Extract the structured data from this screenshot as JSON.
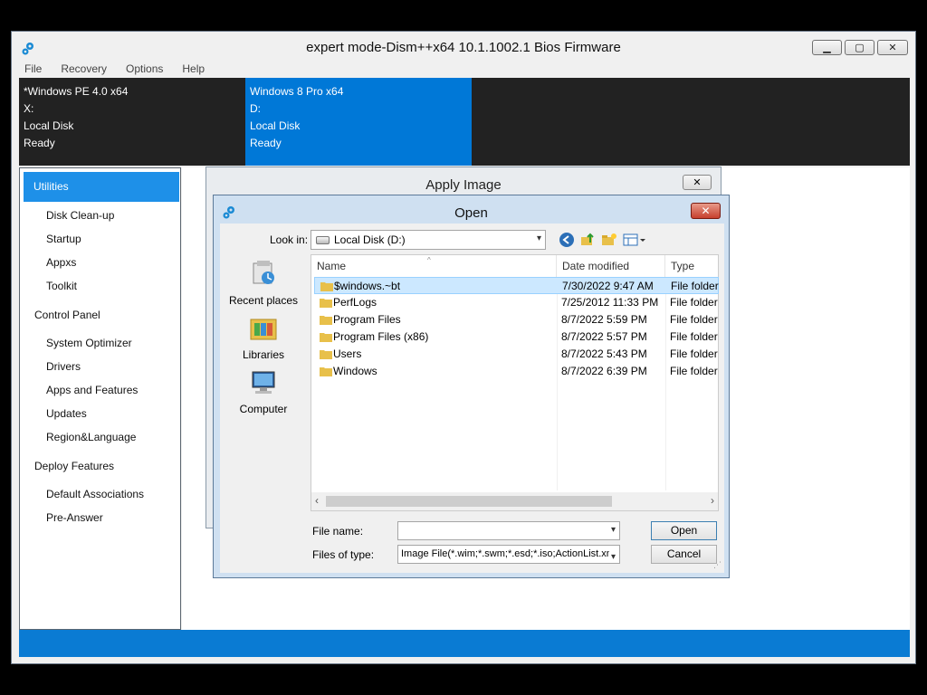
{
  "window": {
    "title": "expert mode-Dism++x64 10.1.1002.1 Bios Firmware",
    "minimize_icon": "minimize-icon",
    "maximize_icon": "maximize-icon",
    "close_icon": "close-icon"
  },
  "menu": [
    "File",
    "Recovery",
    "Options",
    "Help"
  ],
  "systems": [
    {
      "name": "*Windows PE 4.0 x64",
      "drive": "X:",
      "type": "Local Disk",
      "status": "Ready"
    },
    {
      "name": "Windows 8 Pro x64",
      "drive": "D:",
      "type": "Local Disk",
      "status": "Ready"
    }
  ],
  "sidebar": {
    "active": "Utilities",
    "utilities": [
      "Disk Clean-up",
      "Startup",
      "Appxs",
      "Toolkit"
    ],
    "control_panel": "Control Panel",
    "control_panel_items": [
      "System Optimizer",
      "Drivers",
      "Apps and Features",
      "Updates",
      "Region&Language"
    ],
    "deploy_features": "Deploy Features",
    "deploy_items": [
      "Default Associations",
      "Pre-Answer"
    ]
  },
  "apply_dialog": {
    "title": "Apply Image"
  },
  "open_dialog": {
    "title": "Open",
    "look_in_label": "Look in:",
    "look_in_value": "Local Disk (D:)",
    "places": [
      "Recent places",
      "Libraries",
      "Computer"
    ],
    "columns": [
      "Name",
      "Date modified",
      "Type"
    ],
    "files": [
      {
        "name": "$windows.~bt",
        "date": "7/30/2022 9:47 AM",
        "type": "File folder"
      },
      {
        "name": "PerfLogs",
        "date": "7/25/2012 11:33 PM",
        "type": "File folder"
      },
      {
        "name": "Program Files",
        "date": "8/7/2022 5:59 PM",
        "type": "File folder"
      },
      {
        "name": "Program Files (x86)",
        "date": "8/7/2022 5:57 PM",
        "type": "File folder"
      },
      {
        "name": "Users",
        "date": "8/7/2022 5:43 PM",
        "type": "File folder"
      },
      {
        "name": "Windows",
        "date": "8/7/2022 6:39 PM",
        "type": "File folder"
      }
    ],
    "file_name_label": "File name:",
    "file_name_value": "",
    "files_of_type_label": "Files of type:",
    "files_of_type_value": "Image File(*.wim;*.swm;*.esd;*.iso;ActionList.xm",
    "open_button": "Open",
    "cancel_button": "Cancel"
  },
  "colors": {
    "accent": "#0078d7",
    "sidebar_active": "#1e90e8",
    "bottom_bar": "#0a7bd3",
    "dark_strip": "#222222"
  }
}
